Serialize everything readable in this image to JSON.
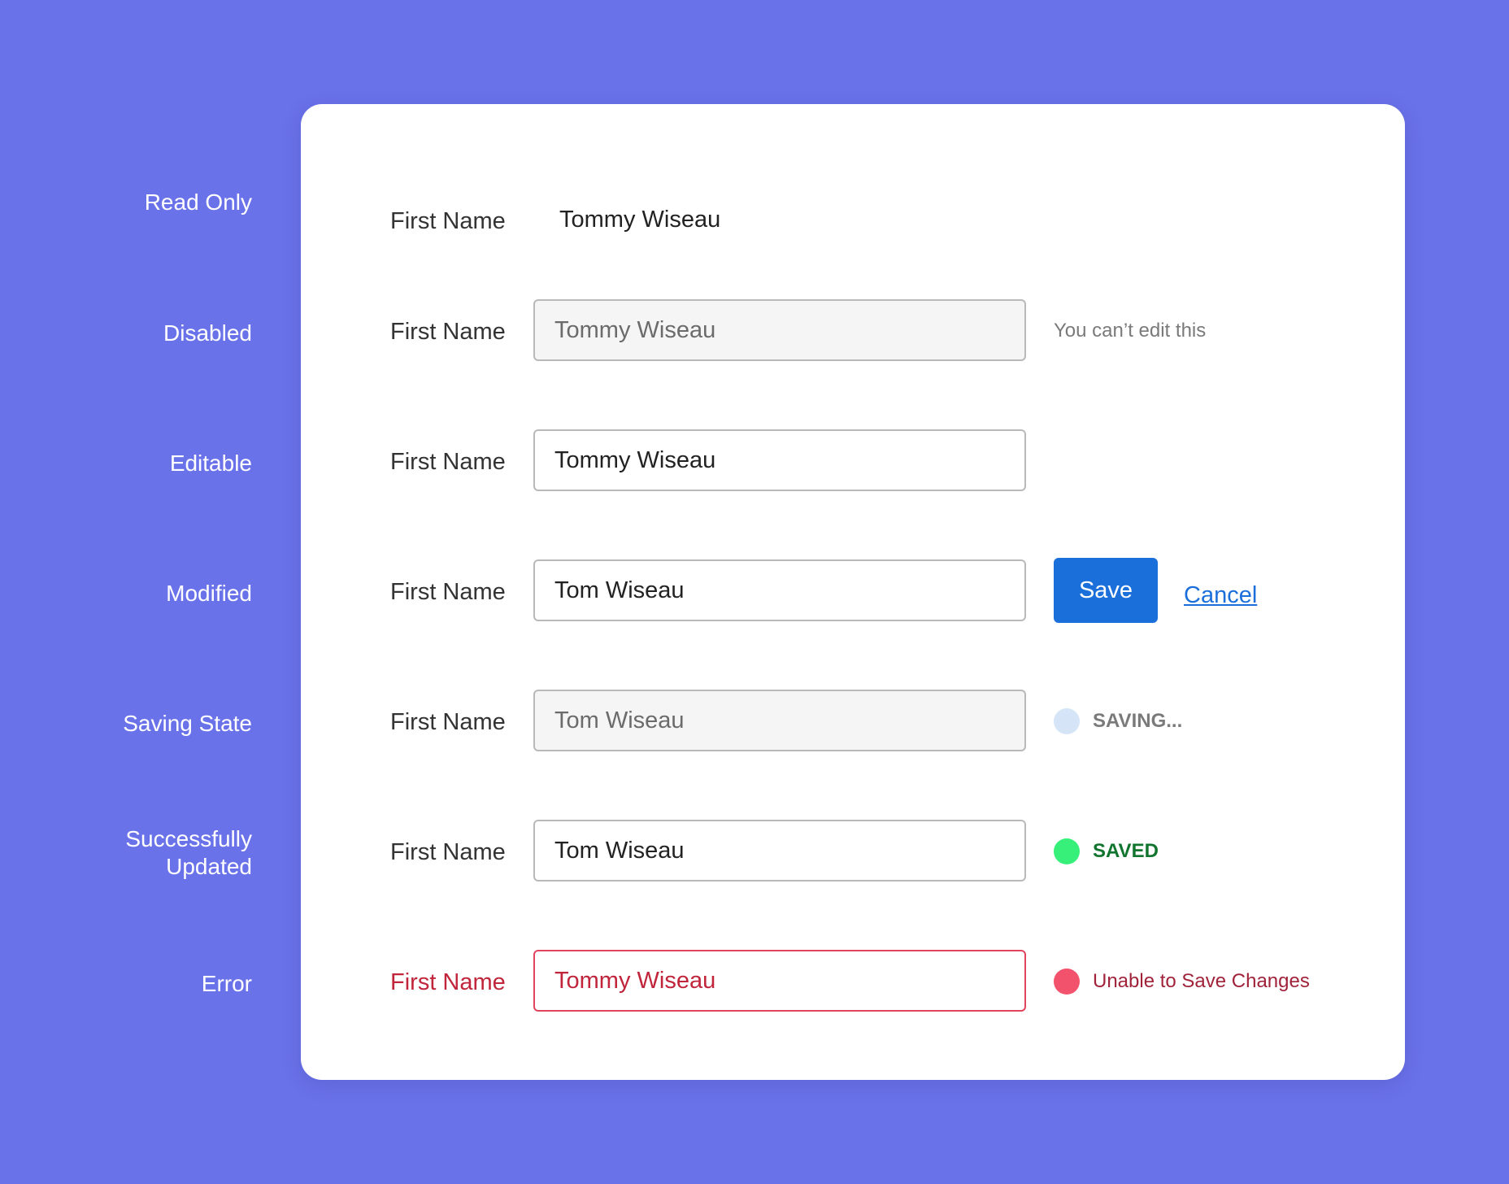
{
  "field_label": "First Name",
  "states": [
    {
      "id": "read-only",
      "label": "Read Only"
    },
    {
      "id": "disabled",
      "label": "Disabled"
    },
    {
      "id": "editable",
      "label": "Editable"
    },
    {
      "id": "modified",
      "label": "Modified"
    },
    {
      "id": "saving",
      "label": "Saving State"
    },
    {
      "id": "success",
      "label": "Successfully\nUpdated"
    },
    {
      "id": "error",
      "label": "Error"
    }
  ],
  "rows": {
    "read_only": {
      "value": "Tommy Wiseau"
    },
    "disabled": {
      "value": "Tommy Wiseau",
      "hint": "You can’t edit this"
    },
    "editable": {
      "value": "Tommy Wiseau"
    },
    "modified": {
      "value": "Tom Wiseau",
      "save_label": "Save",
      "cancel_label": "Cancel"
    },
    "saving": {
      "value": "Tom Wiseau",
      "status": "SAVING...",
      "dot_color": "#d5e4f7",
      "text_color": "#7a7a7a"
    },
    "success": {
      "value": "Tom Wiseau",
      "status": "SAVED",
      "dot_color": "#37f07a",
      "text_color": "#12752f"
    },
    "error": {
      "value": "Tommy Wiseau",
      "status": "Unable to Save Changes",
      "dot_color": "#f2526b",
      "text_color": "#a0233a"
    }
  },
  "colors": {
    "background": "#6a72ea",
    "card": "#ffffff",
    "primary": "#1a6fdb",
    "error": "#c0253b"
  }
}
